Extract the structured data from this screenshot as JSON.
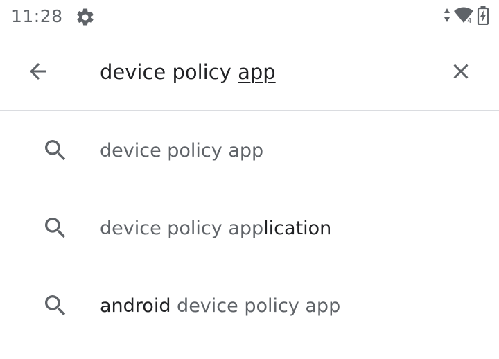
{
  "status_bar": {
    "time": "11:28",
    "icons": [
      "settings-gear-icon",
      "data-arrows-icon",
      "wifi-icon",
      "battery-charging-icon"
    ]
  },
  "search": {
    "query_prefix": "device policy ",
    "query_composing": "app",
    "icons": {
      "back": "arrow-back-icon",
      "clear": "close-icon"
    }
  },
  "suggestions": [
    {
      "icon": "search-icon",
      "parts": [
        {
          "text": "device policy app",
          "style": "dim"
        }
      ]
    },
    {
      "icon": "search-icon",
      "parts": [
        {
          "text": "device policy app",
          "style": "dim"
        },
        {
          "text": "lication",
          "style": "bold"
        }
      ]
    },
    {
      "icon": "search-icon",
      "parts": [
        {
          "text": "android",
          "style": "bold"
        },
        {
          "text": " device policy app",
          "style": "dim"
        }
      ]
    }
  ],
  "colors": {
    "primary_text": "#202124",
    "secondary_text": "#5f6368",
    "divider": "#dadce0",
    "icon": "#5f6368"
  }
}
